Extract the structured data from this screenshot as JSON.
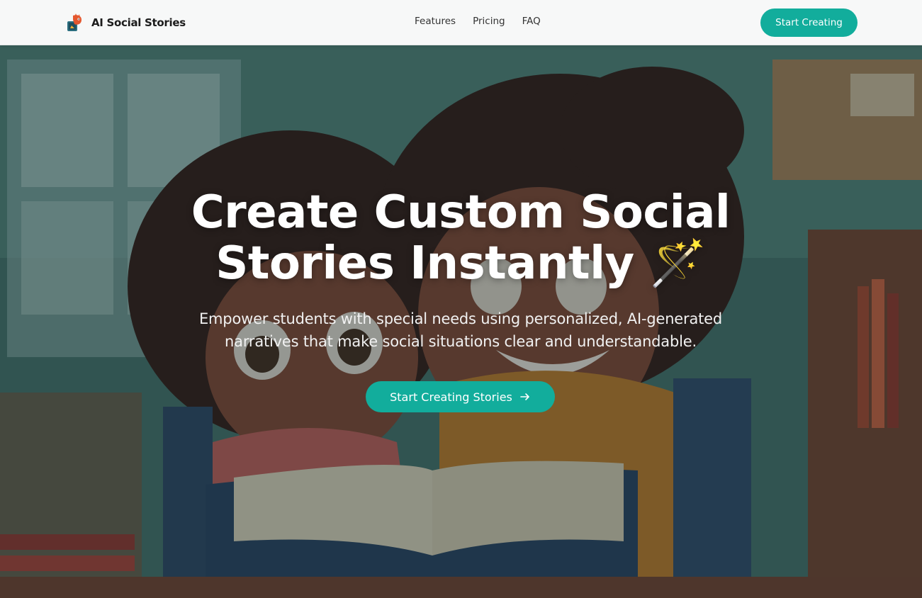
{
  "navbar": {
    "brand": "AI Social Stories",
    "links": [
      "Features",
      "Pricing",
      "FAQ"
    ],
    "cta_label": "Start Creating"
  },
  "hero": {
    "title": "Create Custom Social Stories Instantly 🪄",
    "subtitle": "Empower students with special needs using personalized, AI-generated narratives that make social situations clear and understandable.",
    "cta_label": "Start Creating Stories",
    "cta_icon": "arrow-right-icon",
    "background_image": "illustration of two girls reading a book in a classroom"
  },
  "colors": {
    "accent": "#12ad9c",
    "navbar_bg": "#f7f8f8",
    "hero_overlay": "#1f3030"
  }
}
